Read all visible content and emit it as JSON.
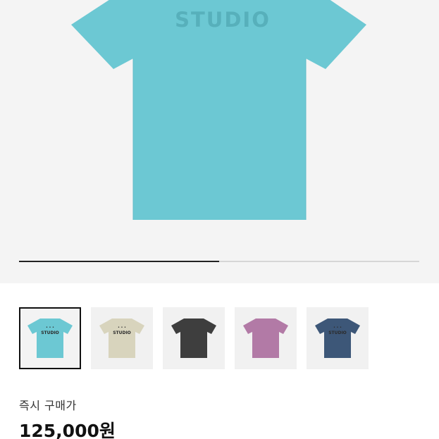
{
  "product": {
    "print_text": "STUDIO",
    "main_color": "#6cc8d3"
  },
  "gallery": {
    "progress": 0.5
  },
  "thumbnails": [
    {
      "color_name": "aqua",
      "color": "#6cc8d3",
      "print": "STUDIO",
      "selected": true
    },
    {
      "color_name": "beige",
      "color": "#d8d4bd",
      "print": "STUDIO",
      "selected": false
    },
    {
      "color_name": "charcoal",
      "color": "#3e3e3e",
      "print": "",
      "selected": false
    },
    {
      "color_name": "mauve",
      "color": "#b27aa6",
      "print": "",
      "selected": false
    },
    {
      "color_name": "navy",
      "color": "#3d5778",
      "print": "STUDIO",
      "selected": false
    }
  ],
  "price": {
    "label": "즉시 구매가",
    "value": "125,000원"
  }
}
